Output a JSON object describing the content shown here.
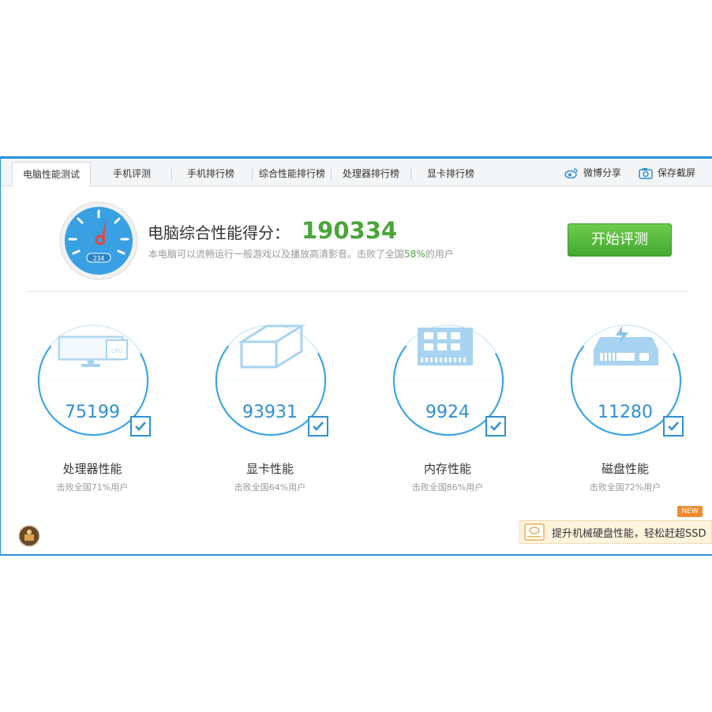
{
  "tabs": [
    {
      "label": "电脑性能测试",
      "active": true
    },
    {
      "label": "手机评测"
    },
    {
      "label": "手机排行榜"
    },
    {
      "label": "综合性能排行榜"
    },
    {
      "label": "处理器排行榜"
    },
    {
      "label": "显卡排行榜"
    }
  ],
  "tools": {
    "share_label": "微博分享",
    "screenshot_label": "保存截屏"
  },
  "gauge": {
    "display": "234"
  },
  "score": {
    "title": "电脑综合性能得分：",
    "value": "190334",
    "desc_prefix": "本电脑可以流畅运行一般游戏以及播放高清影音。击败了全国",
    "desc_pct": "58%",
    "desc_suffix": "的用户"
  },
  "start_button": "开始评测",
  "metrics": [
    {
      "value": "75199",
      "label": "处理器性能",
      "sub": "击败全国71%用户",
      "icon": "monitor-cpu-icon"
    },
    {
      "value": "93931",
      "label": "显卡性能",
      "sub": "击败全国64%用户",
      "icon": "gpu-cube-icon"
    },
    {
      "value": "9924",
      "label": "内存性能",
      "sub": "击败全国86%用户",
      "icon": "memory-chip-icon"
    },
    {
      "value": "11280",
      "label": "磁盘性能",
      "sub": "击败全国72%用户",
      "icon": "disk-drive-icon"
    }
  ],
  "ssd_banner": {
    "text": "提升机械硬盘性能，轻松赶超SSD",
    "badge": "NEW"
  },
  "colors": {
    "accent": "#2f8fd2",
    "green": "#4ba53b",
    "window_border": "#2a8fd8"
  }
}
